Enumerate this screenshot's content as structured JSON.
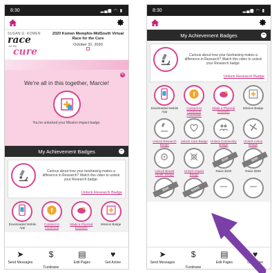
{
  "left": {
    "status": {
      "time": "8:30",
      "icons": "▂▄▆ ◠ ▮"
    },
    "event": {
      "logo_top": "SUSAN G. KOMEN",
      "logo_race": "race",
      "logo_for": "for the",
      "logo_cure": "cure",
      "title": "2020 Komen Memphis-MidSouth Virtual Race for the Cure",
      "date": "October 31, 2020"
    },
    "message": {
      "title": "We're all in this together, Marcie!",
      "subtitle": "You've unlocked your Mission impact badge."
    },
    "section_title": "My Achievement Badges",
    "research": {
      "text": "Curious about how your fundraising makes a difference in Research? Watch this video to unlock your Research badge.",
      "link": "Unlock Research Badge"
    },
    "badges": [
      {
        "label": "Downloaded Mobile App",
        "style": "earned",
        "link": false,
        "icon": "phone-icon"
      },
      {
        "label": "Connect to Facebook",
        "style": "earned",
        "link": true,
        "icon": "facebook-icon"
      },
      {
        "label": "Made a Physical Donation",
        "style": "earned",
        "link": true,
        "icon": "piggy-bank-icon"
      },
      {
        "label": "Mission Badge",
        "style": "earned",
        "link": false,
        "icon": "mission-icon"
      }
    ]
  },
  "right": {
    "status": {
      "time": "8:30",
      "icons": "▂▄▆ ◠ ▮"
    },
    "section_title": "My Achievement Badges",
    "research": {
      "text": "Curious about how your fundraising makes a difference in Research? Watch this video to unlock your Research badge.",
      "link": "Unlock Research Badge"
    },
    "badges": [
      {
        "label": "Downloaded Mobile App",
        "style": "earned",
        "link": false,
        "icon": "phone-icon"
      },
      {
        "label": "Connect to Facebook Fundraiser",
        "style": "earned",
        "link": true,
        "icon": "facebook-icon"
      },
      {
        "label": "Made a Physical Donation",
        "style": "earned",
        "link": true,
        "icon": "piggy-bank-icon"
      },
      {
        "label": "Mission Badge",
        "style": "locked",
        "link": false,
        "icon": "mission-icon"
      },
      {
        "label": "Unlock Research Badge",
        "style": "locked",
        "link": true,
        "icon": "microscope-icon"
      },
      {
        "label": "Unlock Care Badge",
        "style": "locked",
        "link": true,
        "icon": "care-icon"
      },
      {
        "label": "Unlock Community Badge",
        "style": "locked",
        "link": true,
        "icon": "community-icon"
      },
      {
        "label": "Unlock Action Badge",
        "style": "locked",
        "link": true,
        "icon": "action-icon"
      },
      {
        "label": "Unlock Breast Health Badge",
        "style": "locked",
        "link": true,
        "icon": "breast-health-icon"
      },
      {
        "label": "Unlock Impact Badge",
        "style": "locked",
        "link": true,
        "icon": "impact-icon"
      },
      {
        "label": "Raise $100",
        "style": "ribbon",
        "link": false,
        "icon": "ribbon-icon",
        "ribbon_text": "$100"
      },
      {
        "label": "Raise $250",
        "style": "ribbon",
        "link": false,
        "icon": "ribbon-icon",
        "ribbon_text": "$250"
      },
      {
        "label": "",
        "style": "ribbon",
        "link": false,
        "icon": "ribbon-icon",
        "ribbon_text": "$500"
      },
      {
        "label": "",
        "style": "ribbon",
        "link": false,
        "icon": "ribbon-icon",
        "ribbon_text": "$1000"
      },
      {
        "label": "",
        "style": "locked",
        "link": false,
        "icon": "locked-icon"
      },
      {
        "label": "",
        "style": "locked",
        "link": false,
        "icon": "locked-icon"
      }
    ]
  },
  "tabs": [
    {
      "label": "Send Messages",
      "icon": "paper-plane-icon",
      "glyph": "➤"
    },
    {
      "label": "Fundraise",
      "icon": "dollar-icon",
      "glyph": "$",
      "active": true
    },
    {
      "label": "Edit Pages",
      "icon": "document-icon",
      "glyph": "▤"
    },
    {
      "label": "Get Active",
      "icon": "heartbeat-icon",
      "glyph": "♥"
    }
  ],
  "colors": {
    "accent": "#d9418d",
    "dark": "#2a2a2a",
    "arrow": "#7b3fa8"
  }
}
